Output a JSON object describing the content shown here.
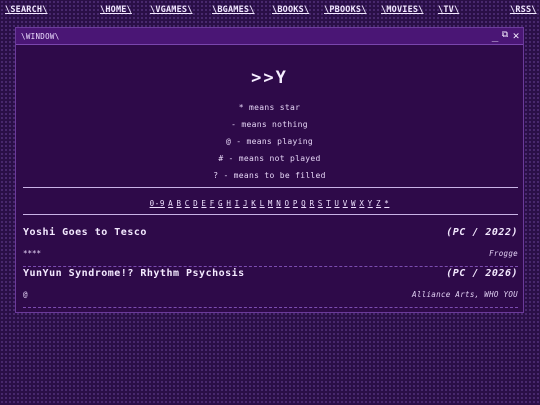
{
  "nav": {
    "search": "\\SEARCH\\",
    "home": "\\HOME\\",
    "vgames": "\\VGAMES\\",
    "bgames": "\\BGAMES\\",
    "books": "\\BOOKS\\",
    "pbooks": "\\PBOOKS\\",
    "movies": "\\MOVIES\\",
    "tv": "\\TV\\",
    "rss": "\\RSS\\"
  },
  "window": {
    "title": "\\WINDOW\\",
    "minimize": "_",
    "restore": "⧉",
    "close": "✕"
  },
  "logo": ">>Y",
  "legend": [
    "* means star",
    "- means nothing",
    "@ - means playing",
    "# - means not played",
    "? - means to be filled"
  ],
  "alphabet": [
    "0-9",
    "A",
    "B",
    "C",
    "D",
    "E",
    "F",
    "G",
    "H",
    "I",
    "J",
    "K",
    "L",
    "M",
    "N",
    "O",
    "P",
    "Q",
    "R",
    "S",
    "T",
    "U",
    "V",
    "W",
    "X",
    "Y",
    "Z",
    "*"
  ],
  "entries": [
    {
      "title": "Yoshi Goes to Tesco",
      "platform": "(PC / 2022)",
      "rating": "****",
      "author": "Frogge"
    },
    {
      "title": "YunYun Syndrome!? Rhythm Psychosis",
      "platform": "(PC / 2026)",
      "rating": "@",
      "author": "Alliance Arts, WHO YOU"
    }
  ]
}
